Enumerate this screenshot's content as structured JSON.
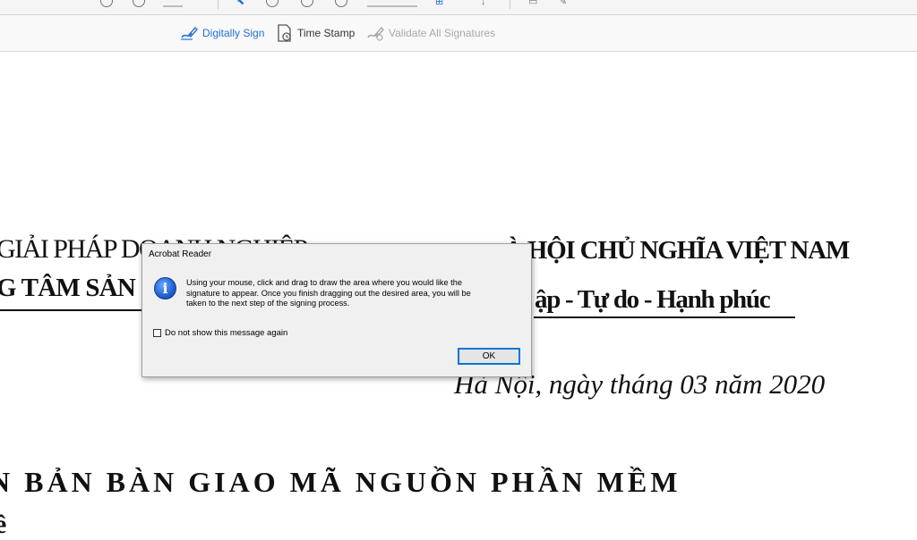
{
  "toolbar": {
    "digitally_sign_label": "Digitally Sign",
    "time_stamp_label": "Time Stamp",
    "validate_label": "Validate All Signatures",
    "accent_color": "#2470d6"
  },
  "document": {
    "line1_left": "GIẢI PHÁP DOANH NGHIỆP",
    "line1_right": "À HỘI CHỦ NGHĨA VIỆT NAM",
    "line2_left": "G TÂM SẢN",
    "line2_right": "ập - Tự do - Hạnh phúc",
    "date_line": "Hà Nội, ngày   tháng 03 năm 2020",
    "title_line": "N BẢN BÀN GIAO MÃ NGUỒN PHẦN MỀM",
    "last_line": "ề"
  },
  "dialog": {
    "title": "Acrobat Reader",
    "message": "Using your mouse, click and drag to draw the area where you would like the signature to appear. Once you finish dragging out the desired area, you will be taken to the next step of the signing process.",
    "checkbox_label": "Do not show this message again",
    "ok_label": "OK",
    "icon": "info-icon"
  }
}
